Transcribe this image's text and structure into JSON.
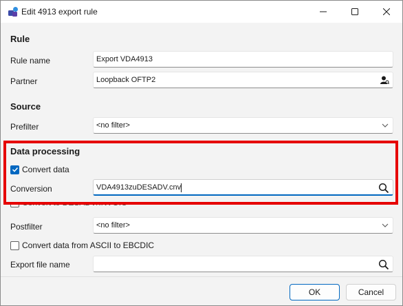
{
  "window": {
    "title": "Edit 4913 export rule"
  },
  "sections": {
    "rule": "Rule",
    "source": "Source",
    "data_processing": "Data processing"
  },
  "fields": {
    "rule_name": {
      "label": "Rule name",
      "value": "Export VDA4913"
    },
    "partner": {
      "label": "Partner",
      "value": "Loopback OFTP2"
    },
    "prefilter": {
      "label": "Prefilter",
      "value": "<no filter>"
    },
    "convert_data": {
      "label": "Convert data",
      "checked": true
    },
    "conversion": {
      "label": "Conversion",
      "value": "VDA4913zuDESADV.cnv"
    },
    "convert_to_desadv": {
      "label": "Convert to DESADV/INVOIC"
    },
    "postfilter": {
      "label": "Postfilter",
      "value": "<no filter>"
    },
    "ascii_ebcdic": {
      "label": "Convert data from ASCII to EBCDIC",
      "checked": false
    },
    "export_file_name": {
      "label": "Export file name",
      "value": ""
    }
  },
  "buttons": {
    "ok": "OK",
    "cancel": "Cancel"
  },
  "icons": {
    "app": "app-logo-icon",
    "partner": "person-lookup-icon",
    "search": "search-icon",
    "chevron": "chevron-down-icon"
  },
  "colors": {
    "accent": "#0067c0",
    "highlight": "#e60000"
  }
}
